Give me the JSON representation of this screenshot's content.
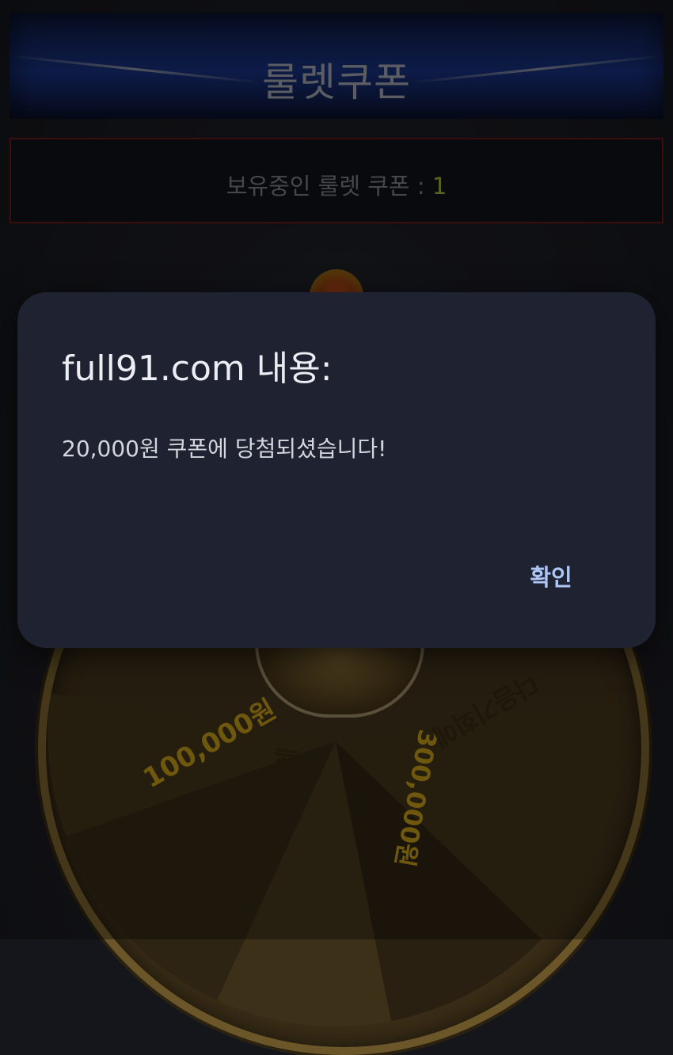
{
  "page": {
    "title": "룰렛쿠폰",
    "coupon_label": "보유중인 룰렛 쿠폰 : ",
    "coupon_count": "1"
  },
  "wheel": {
    "prizes": [
      "100,000원",
      "다음기회에",
      "300,000원",
      "다음기회에"
    ]
  },
  "dialog": {
    "title": "full91.com 내용:",
    "message": "20,000원 쿠폰에 당첨되셨습니다!",
    "ok_label": "확인"
  },
  "colors": {
    "dialog_bg": "#1f2230",
    "ok_button": "#aec6f6",
    "coupon_count": "#8f9d2e",
    "coupon_border": "#5a1616"
  }
}
